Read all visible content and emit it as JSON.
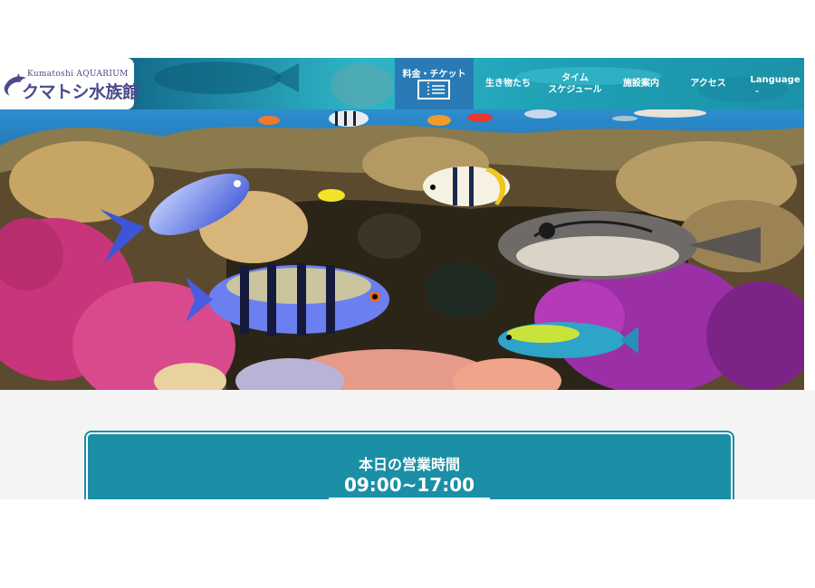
{
  "logo": {
    "en": "Kumatoshi  AQUARIUM",
    "jp": "クマトシ水族館"
  },
  "nav": {
    "ticket": "料金・チケット",
    "creatures": "生き物たち",
    "time_line1": "タイム",
    "time_line2": "スケジュール",
    "facility": "施設案内",
    "access": "アクセス",
    "language": "Language",
    "language_chevron": "⌄"
  },
  "hours": {
    "title": "本日の営業時間",
    "time": "09:00~17:00"
  },
  "colors": {
    "header": "#2eb5c6",
    "ticket_bg": "#2a7bb5",
    "card": "#1a8fa6",
    "logo_text": "#4a4b8c"
  }
}
